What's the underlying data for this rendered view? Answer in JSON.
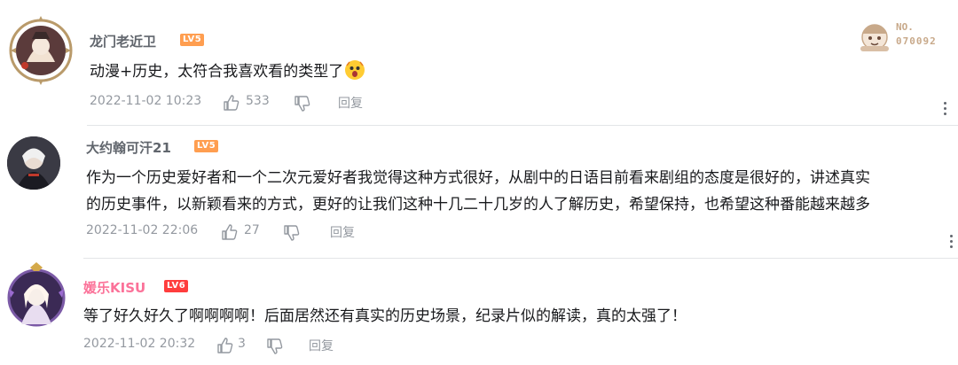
{
  "comments": [
    {
      "username": "龙门老近卫",
      "level": "LV5",
      "text": "动漫+历史，太符合我喜欢看的类型了",
      "emoji": "shocked-emoji-icon",
      "time": "2022-11-02 10:23",
      "likes": "533",
      "reply": "回复"
    },
    {
      "username": "大约翰可汗21",
      "level": "LV5",
      "text_line1": "作为一个历史爱好者和一个二次元爱好者我觉得这种方式很好，从剧中的日语目前看来剧组的态度是很好的，讲述真实",
      "text_line2": "的历史事件，以新颖看来的方式，更好的让我们这种十几二十几岁的人了解历史，希望保持，也希望这种番能越来越多",
      "time": "2022-11-02 22:06",
      "likes": "27",
      "reply": "回复"
    },
    {
      "username": "媛乐KISU",
      "level": "LV6",
      "text": "等了好久好久了啊啊啊啊！后面居然还有真实的历史场景，纪录片似的解读，真的太强了！",
      "time": "2022-11-02 20:32",
      "likes": "3",
      "reply": "回复"
    }
  ],
  "badge": {
    "label": "NO.",
    "number": "070092"
  },
  "colors": {
    "lv5": "#ff9e50",
    "lv6": "#ff3d3d",
    "vip_name": "#fb7299"
  }
}
